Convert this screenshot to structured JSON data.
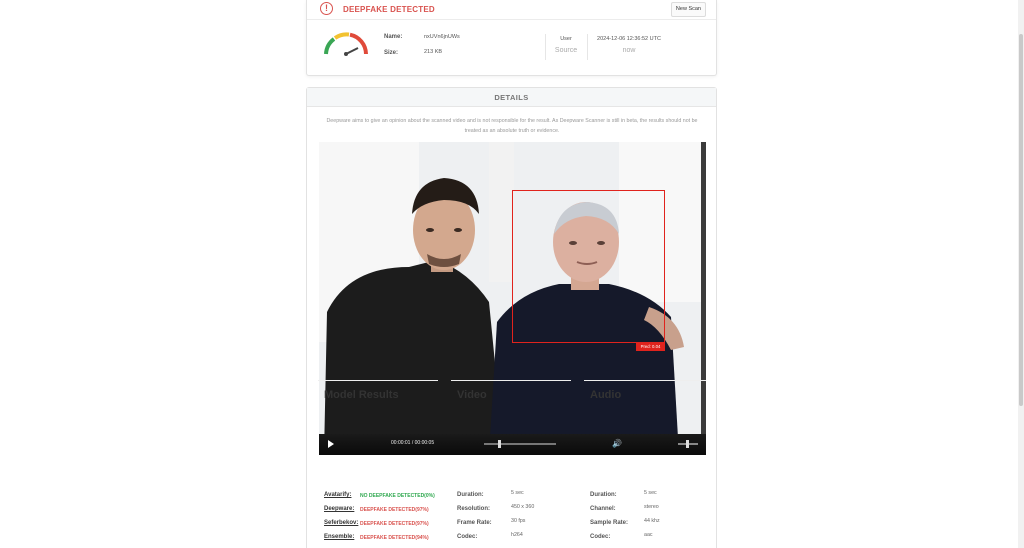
{
  "header": {
    "alert_icon": "!",
    "alert_title": "DEEPFAKE DETECTED",
    "new_scan_label": "New Scan"
  },
  "file_info": {
    "name_label": "Name:",
    "name_value": "nxUVn6jnUWs",
    "size_label": "Size:",
    "size_value": "213 KB",
    "meta_user_head": "User",
    "meta_user_sub": "Source",
    "meta_date_head": "2024-12-06 12:36:52 UTC",
    "meta_date_sub": "now"
  },
  "details": {
    "title": "DETAILS",
    "disclaimer_line1": "Deepware aims to give an opinion about the scanned video and is not responsible for the result. As Deepware Scanner is still in beta, the results should not be",
    "disclaimer_line2": "treated as an absolute truth or evidence."
  },
  "video": {
    "pred_label": "Pred: 0.04",
    "time_current": "00:00:01",
    "time_total": "00:00:05",
    "timecode": "00:00:01 / 00:00:05",
    "progress": 0.2,
    "volume": 0.5
  },
  "model_results": {
    "heading": "Model Results",
    "items": [
      {
        "name": "Avatarify:",
        "status": "NO DEEPFAKE DETECTED(0%)",
        "color": "#2fa84f"
      },
      {
        "name": "Deepware:",
        "status": "DEEPFAKE DETECTED(97%)",
        "color": "#d9534f"
      },
      {
        "name": "Seferbekov:",
        "status": "DEEPFAKE DETECTED(97%)",
        "color": "#d9534f"
      },
      {
        "name": "Ensemble:",
        "status": "DEEPFAKE DETECTED(94%)",
        "color": "#d9534f"
      }
    ]
  },
  "video_info": {
    "heading": "Video",
    "rows": [
      {
        "label": "Duration:",
        "value": "5 sec"
      },
      {
        "label": "Resolution:",
        "value": "450 x 360"
      },
      {
        "label": "Frame Rate:",
        "value": "30 fps"
      },
      {
        "label": "Codec:",
        "value": "h264"
      }
    ]
  },
  "audio_info": {
    "heading": "Audio",
    "rows": [
      {
        "label": "Duration:",
        "value": "5 sec"
      },
      {
        "label": "Channel:",
        "value": "stereo"
      },
      {
        "label": "Sample Rate:",
        "value": "44 khz"
      },
      {
        "label": "Codec:",
        "value": "aac"
      }
    ]
  },
  "colors": {
    "alert": "#d9534f",
    "face_box": "#e0231d",
    "ok": "#2fa84f"
  },
  "icons": {
    "alert": "alert-circle-icon",
    "gauge": "gauge-icon",
    "play": "play-icon",
    "volume": "volume-icon"
  }
}
